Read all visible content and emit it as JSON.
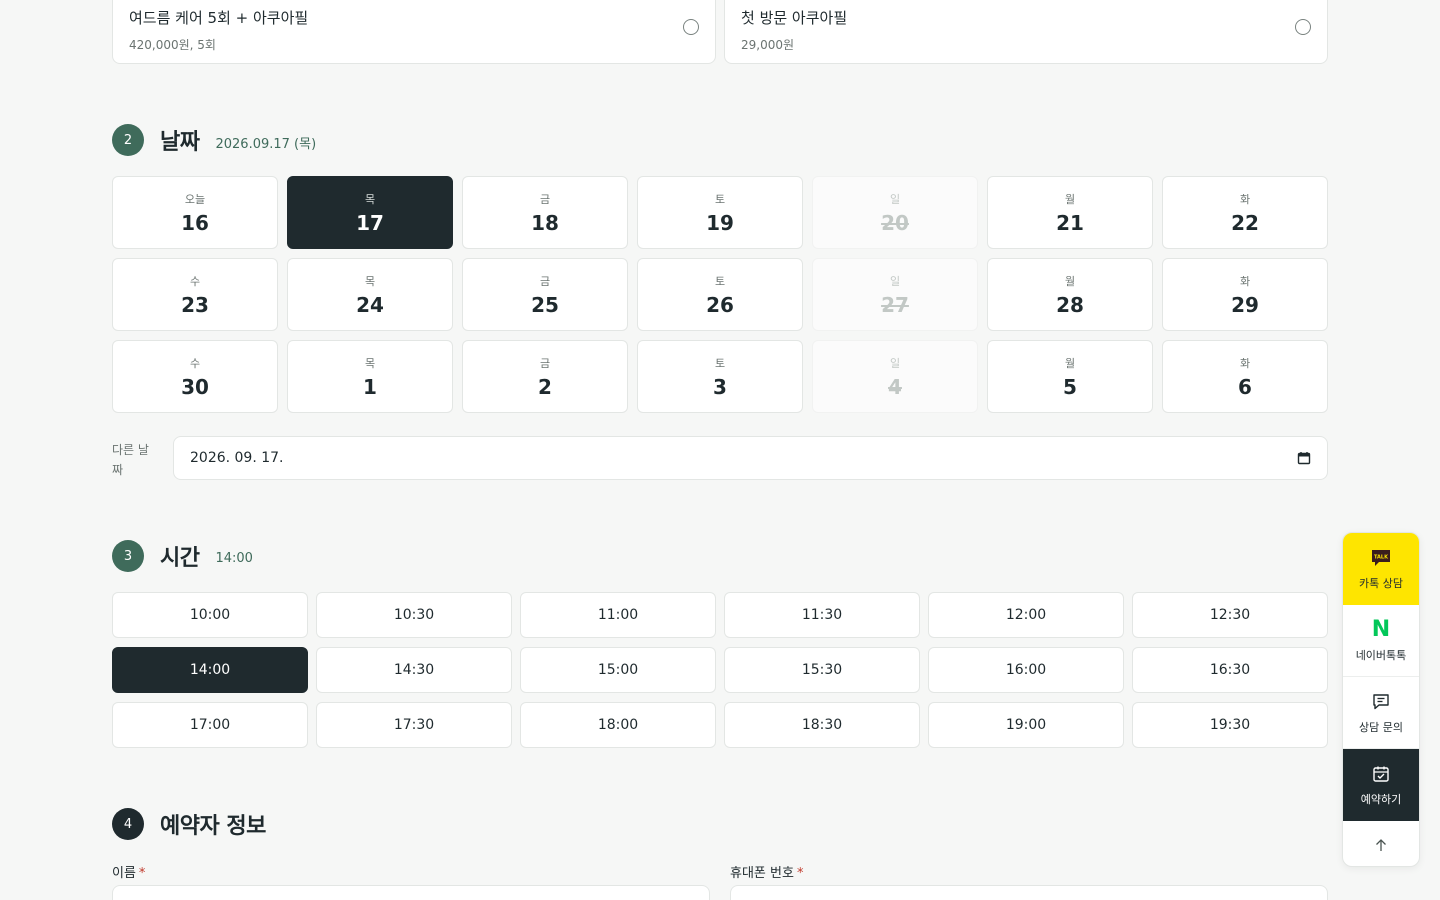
{
  "products": [
    {
      "name": "여드름 케어 5회 + 아쿠아필",
      "price": "420,000원, 5회"
    },
    {
      "name": "첫 방문 아쿠아필",
      "price": "29,000원"
    }
  ],
  "date_section": {
    "number": "2",
    "title": "날짜",
    "selected_text": "2026.09.17 (목)"
  },
  "dates": [
    {
      "dow": "오늘",
      "day": "16",
      "state": "normal"
    },
    {
      "dow": "목",
      "day": "17",
      "state": "selected"
    },
    {
      "dow": "금",
      "day": "18",
      "state": "normal"
    },
    {
      "dow": "토",
      "day": "19",
      "state": "normal"
    },
    {
      "dow": "일",
      "day": "20",
      "state": "disabled"
    },
    {
      "dow": "월",
      "day": "21",
      "state": "normal"
    },
    {
      "dow": "화",
      "day": "22",
      "state": "normal"
    },
    {
      "dow": "수",
      "day": "23",
      "state": "normal"
    },
    {
      "dow": "목",
      "day": "24",
      "state": "normal"
    },
    {
      "dow": "금",
      "day": "25",
      "state": "normal"
    },
    {
      "dow": "토",
      "day": "26",
      "state": "normal"
    },
    {
      "dow": "일",
      "day": "27",
      "state": "disabled"
    },
    {
      "dow": "월",
      "day": "28",
      "state": "normal"
    },
    {
      "dow": "화",
      "day": "29",
      "state": "normal"
    },
    {
      "dow": "수",
      "day": "30",
      "state": "normal"
    },
    {
      "dow": "목",
      "day": "1",
      "state": "normal"
    },
    {
      "dow": "금",
      "day": "2",
      "state": "normal"
    },
    {
      "dow": "토",
      "day": "3",
      "state": "normal"
    },
    {
      "dow": "일",
      "day": "4",
      "state": "disabled"
    },
    {
      "dow": "월",
      "day": "5",
      "state": "normal"
    },
    {
      "dow": "화",
      "day": "6",
      "state": "normal"
    }
  ],
  "other_date": {
    "label": "다른 날짜",
    "value": "2026. 09. 17."
  },
  "time_section": {
    "number": "3",
    "title": "시간",
    "selected_text": "14:00"
  },
  "times": [
    {
      "label": "10:00",
      "selected": false
    },
    {
      "label": "10:30",
      "selected": false
    },
    {
      "label": "11:00",
      "selected": false
    },
    {
      "label": "11:30",
      "selected": false
    },
    {
      "label": "12:00",
      "selected": false
    },
    {
      "label": "12:30",
      "selected": false
    },
    {
      "label": "14:00",
      "selected": true
    },
    {
      "label": "14:30",
      "selected": false
    },
    {
      "label": "15:00",
      "selected": false
    },
    {
      "label": "15:30",
      "selected": false
    },
    {
      "label": "16:00",
      "selected": false
    },
    {
      "label": "16:30",
      "selected": false
    },
    {
      "label": "17:00",
      "selected": false
    },
    {
      "label": "17:30",
      "selected": false
    },
    {
      "label": "18:00",
      "selected": false
    },
    {
      "label": "18:30",
      "selected": false
    },
    {
      "label": "19:00",
      "selected": false
    },
    {
      "label": "19:30",
      "selected": false
    }
  ],
  "info_section": {
    "number": "4",
    "title": "예약자 정보"
  },
  "fields": {
    "name_label": "이름",
    "phone_label": "휴대폰 번호",
    "required_mark": "*"
  },
  "floating": {
    "kakao": "카톡 상담",
    "kakao_badge": "TALK",
    "naver": "네이버톡톡",
    "naver_logo": "N",
    "inquiry": "상담 문의",
    "reserve": "예약하기"
  },
  "colors": {
    "accent": "#3f6b5b",
    "dark": "#1f2a2e",
    "kakao": "#fee500",
    "naver": "#03c75a"
  }
}
